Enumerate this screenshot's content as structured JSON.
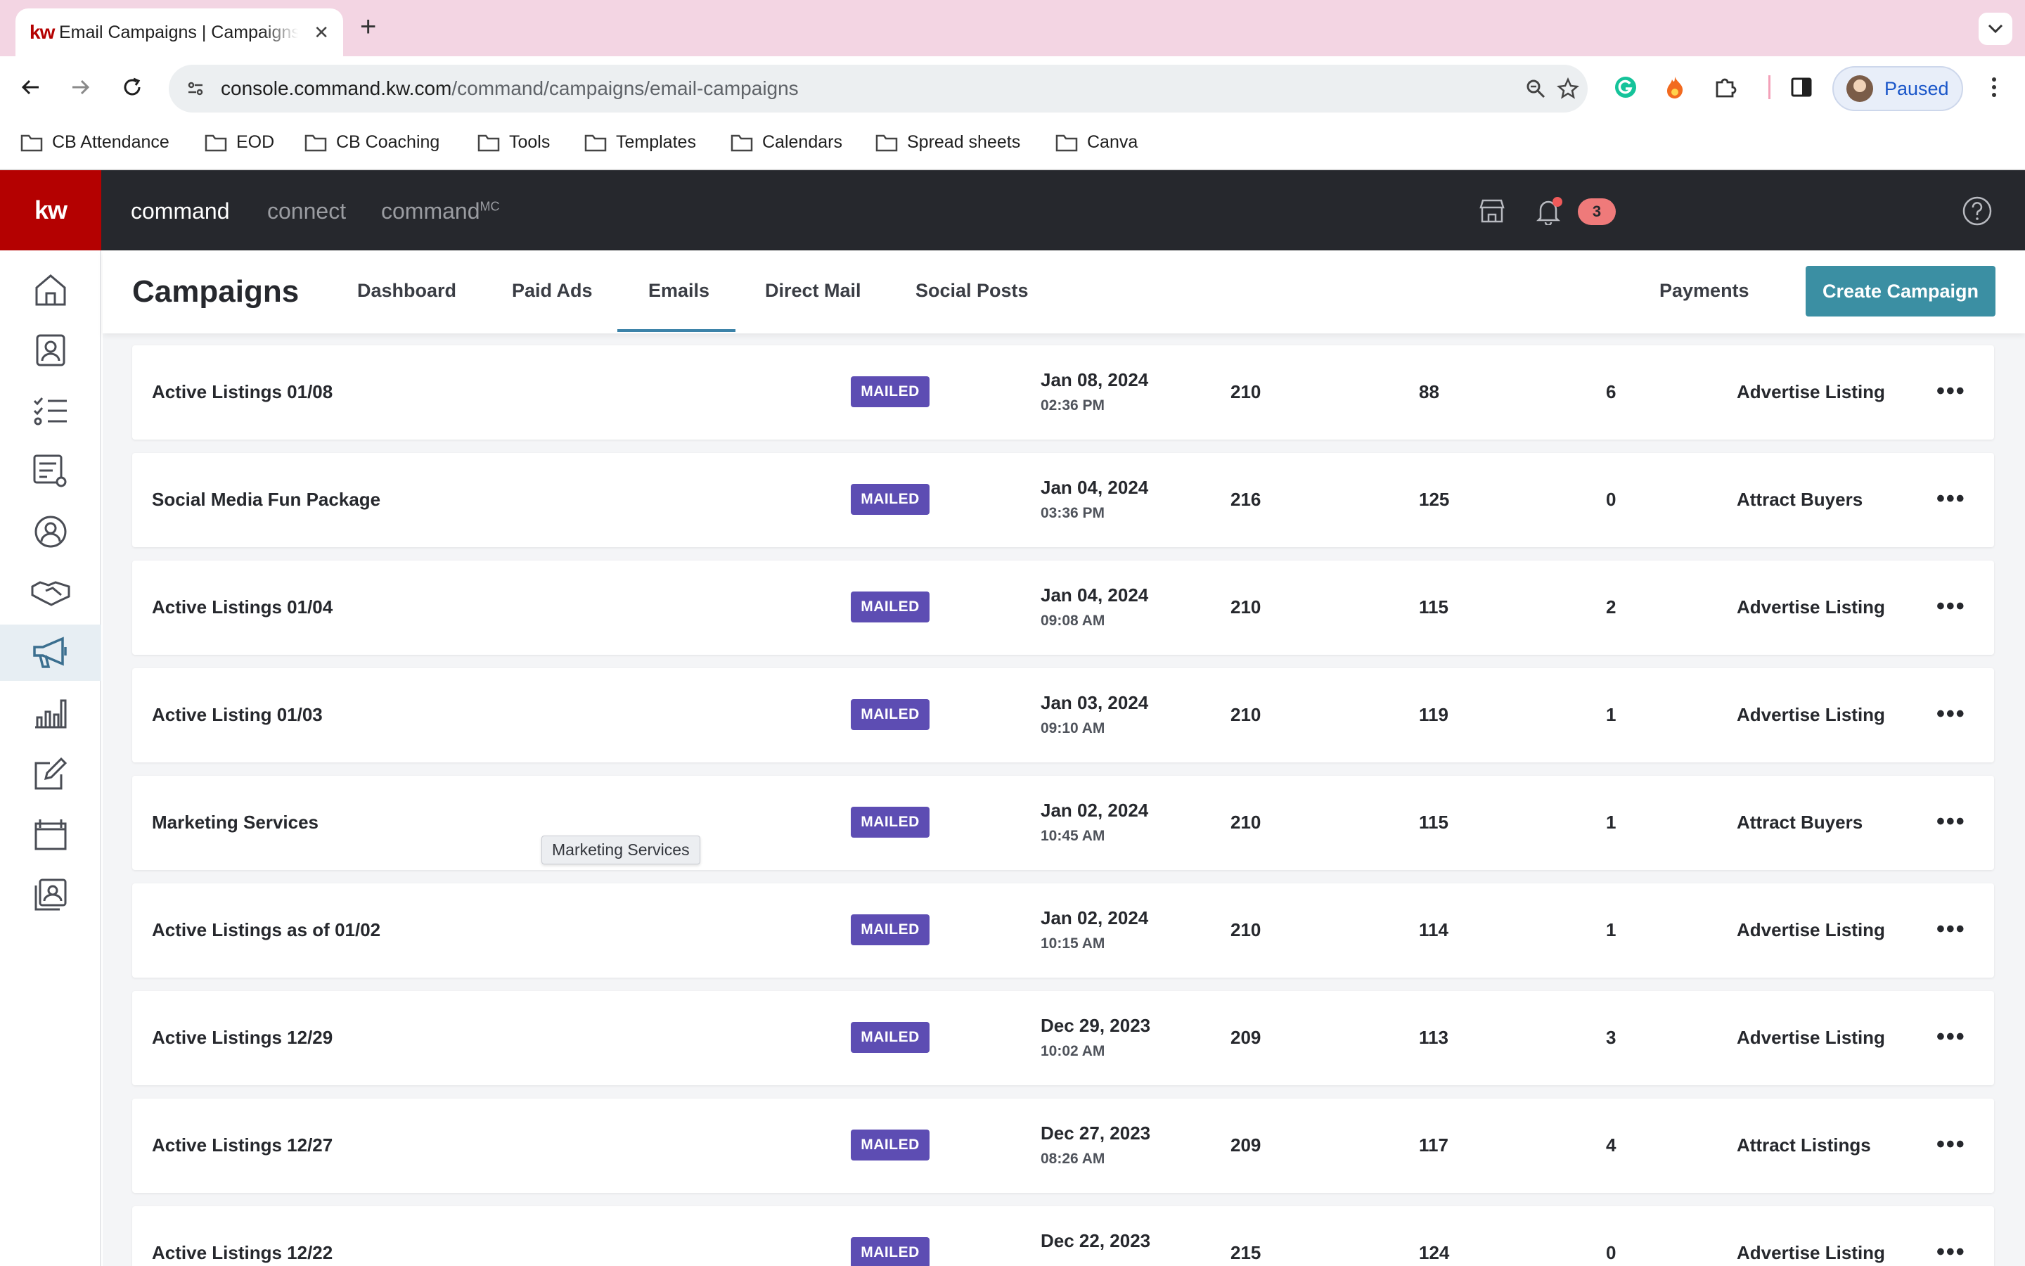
{
  "browser": {
    "tab_title": "Email Campaigns | Campaigns",
    "favicon_text": "kw",
    "url_host": "console.command.kw.com",
    "url_path": "/command/campaigns/email-campaigns",
    "profile_label": "Paused",
    "bookmarks": [
      "CB Attendance",
      "EOD",
      "CB Coaching",
      "Tools",
      "Templates",
      "Calendars",
      "Spread sheets",
      "Canva"
    ]
  },
  "app": {
    "logo": "kw",
    "nav": [
      "command",
      "connect",
      "command"
    ],
    "nav_sup": "MC",
    "notification_count": "3",
    "accent_color": "#3b8fa3",
    "brand_color": "#b40101"
  },
  "sidebar": {
    "items": [
      "home-icon",
      "contacts-icon",
      "tasks-icon",
      "smart-plans-icon",
      "referrals-icon",
      "opportunities-icon",
      "campaigns-icon",
      "insights-icon",
      "designs-icon",
      "storefront-icon",
      "media-icon"
    ],
    "active": "campaigns-icon"
  },
  "page": {
    "title": "Campaigns",
    "tabs": [
      "Dashboard",
      "Paid Ads",
      "Emails",
      "Direct Mail",
      "Social Posts"
    ],
    "active_tab": "Emails",
    "payments_label": "Payments",
    "create_label": "Create Campaign"
  },
  "campaigns": [
    {
      "name": "Active Listings 01/08",
      "status": "MAILED",
      "date": "Jan 08, 2024",
      "time": "02:36 PM",
      "recipients": "210",
      "opens": "88",
      "clicks": "6",
      "type": "Advertise Listing"
    },
    {
      "name": "Social Media Fun Package",
      "status": "MAILED",
      "date": "Jan 04, 2024",
      "time": "03:36 PM",
      "recipients": "216",
      "opens": "125",
      "clicks": "0",
      "type": "Attract Buyers"
    },
    {
      "name": "Active Listings 01/04",
      "status": "MAILED",
      "date": "Jan 04, 2024",
      "time": "09:08 AM",
      "recipients": "210",
      "opens": "115",
      "clicks": "2",
      "type": "Advertise Listing"
    },
    {
      "name": "Active Listing 01/03",
      "status": "MAILED",
      "date": "Jan 03, 2024",
      "time": "09:10 AM",
      "recipients": "210",
      "opens": "119",
      "clicks": "1",
      "type": "Advertise Listing"
    },
    {
      "name": "Marketing Services",
      "status": "MAILED",
      "date": "Jan 02, 2024",
      "time": "10:45 AM",
      "recipients": "210",
      "opens": "115",
      "clicks": "1",
      "type": "Attract Buyers"
    },
    {
      "name": "Active Listings as of 01/02",
      "status": "MAILED",
      "date": "Jan 02, 2024",
      "time": "10:15 AM",
      "recipients": "210",
      "opens": "114",
      "clicks": "1",
      "type": "Advertise Listing"
    },
    {
      "name": "Active Listings 12/29",
      "status": "MAILED",
      "date": "Dec 29, 2023",
      "time": "10:02 AM",
      "recipients": "209",
      "opens": "113",
      "clicks": "3",
      "type": "Advertise Listing"
    },
    {
      "name": "Active Listings 12/27",
      "status": "MAILED",
      "date": "Dec 27, 2023",
      "time": "08:26 AM",
      "recipients": "209",
      "opens": "117",
      "clicks": "4",
      "type": "Attract Listings"
    },
    {
      "name": "Active Listings 12/22",
      "status": "MAILED",
      "date": "Dec 22, 2023",
      "time": "",
      "recipients": "215",
      "opens": "124",
      "clicks": "0",
      "type": "Advertise Listing"
    }
  ],
  "tooltip": "Marketing Services"
}
